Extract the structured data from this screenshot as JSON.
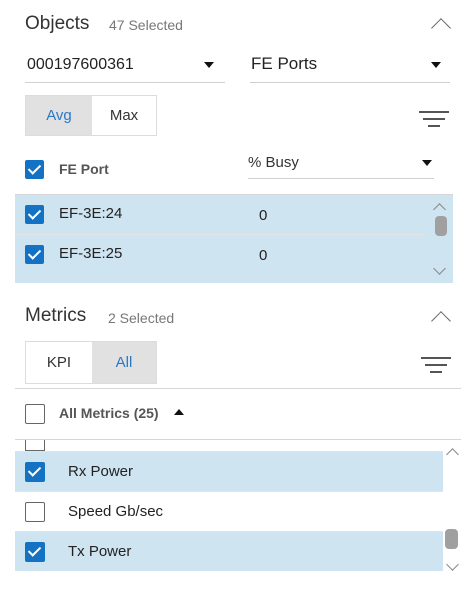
{
  "objects": {
    "title": "Objects",
    "selected": "47 Selected",
    "array_dropdown": "000197600361",
    "type_dropdown": "FE Ports",
    "toggle": {
      "avg": "Avg",
      "max": "Max",
      "active": "avg"
    },
    "table": {
      "col1": "FE Port",
      "col2_dropdown": "% Busy",
      "rows": [
        {
          "port": "EF-3E:24",
          "value": "0",
          "checked": true
        },
        {
          "port": "EF-3E:25",
          "value": "0",
          "checked": true
        }
      ]
    }
  },
  "metrics": {
    "title": "Metrics",
    "selected": "2 Selected",
    "toggle": {
      "kpi": "KPI",
      "all": "All",
      "active": "all"
    },
    "header": "All Metrics (25)",
    "items": [
      {
        "label": "Rx Power",
        "checked": true
      },
      {
        "label": "Speed Gb/sec",
        "checked": false
      },
      {
        "label": "Tx Power",
        "checked": true
      }
    ]
  },
  "icons": [
    "chevron-up-icon",
    "caret-down-icon",
    "filter-icon",
    "checkbox-icon",
    "sort-up-icon",
    "scroll-up-icon",
    "scroll-down-icon"
  ]
}
